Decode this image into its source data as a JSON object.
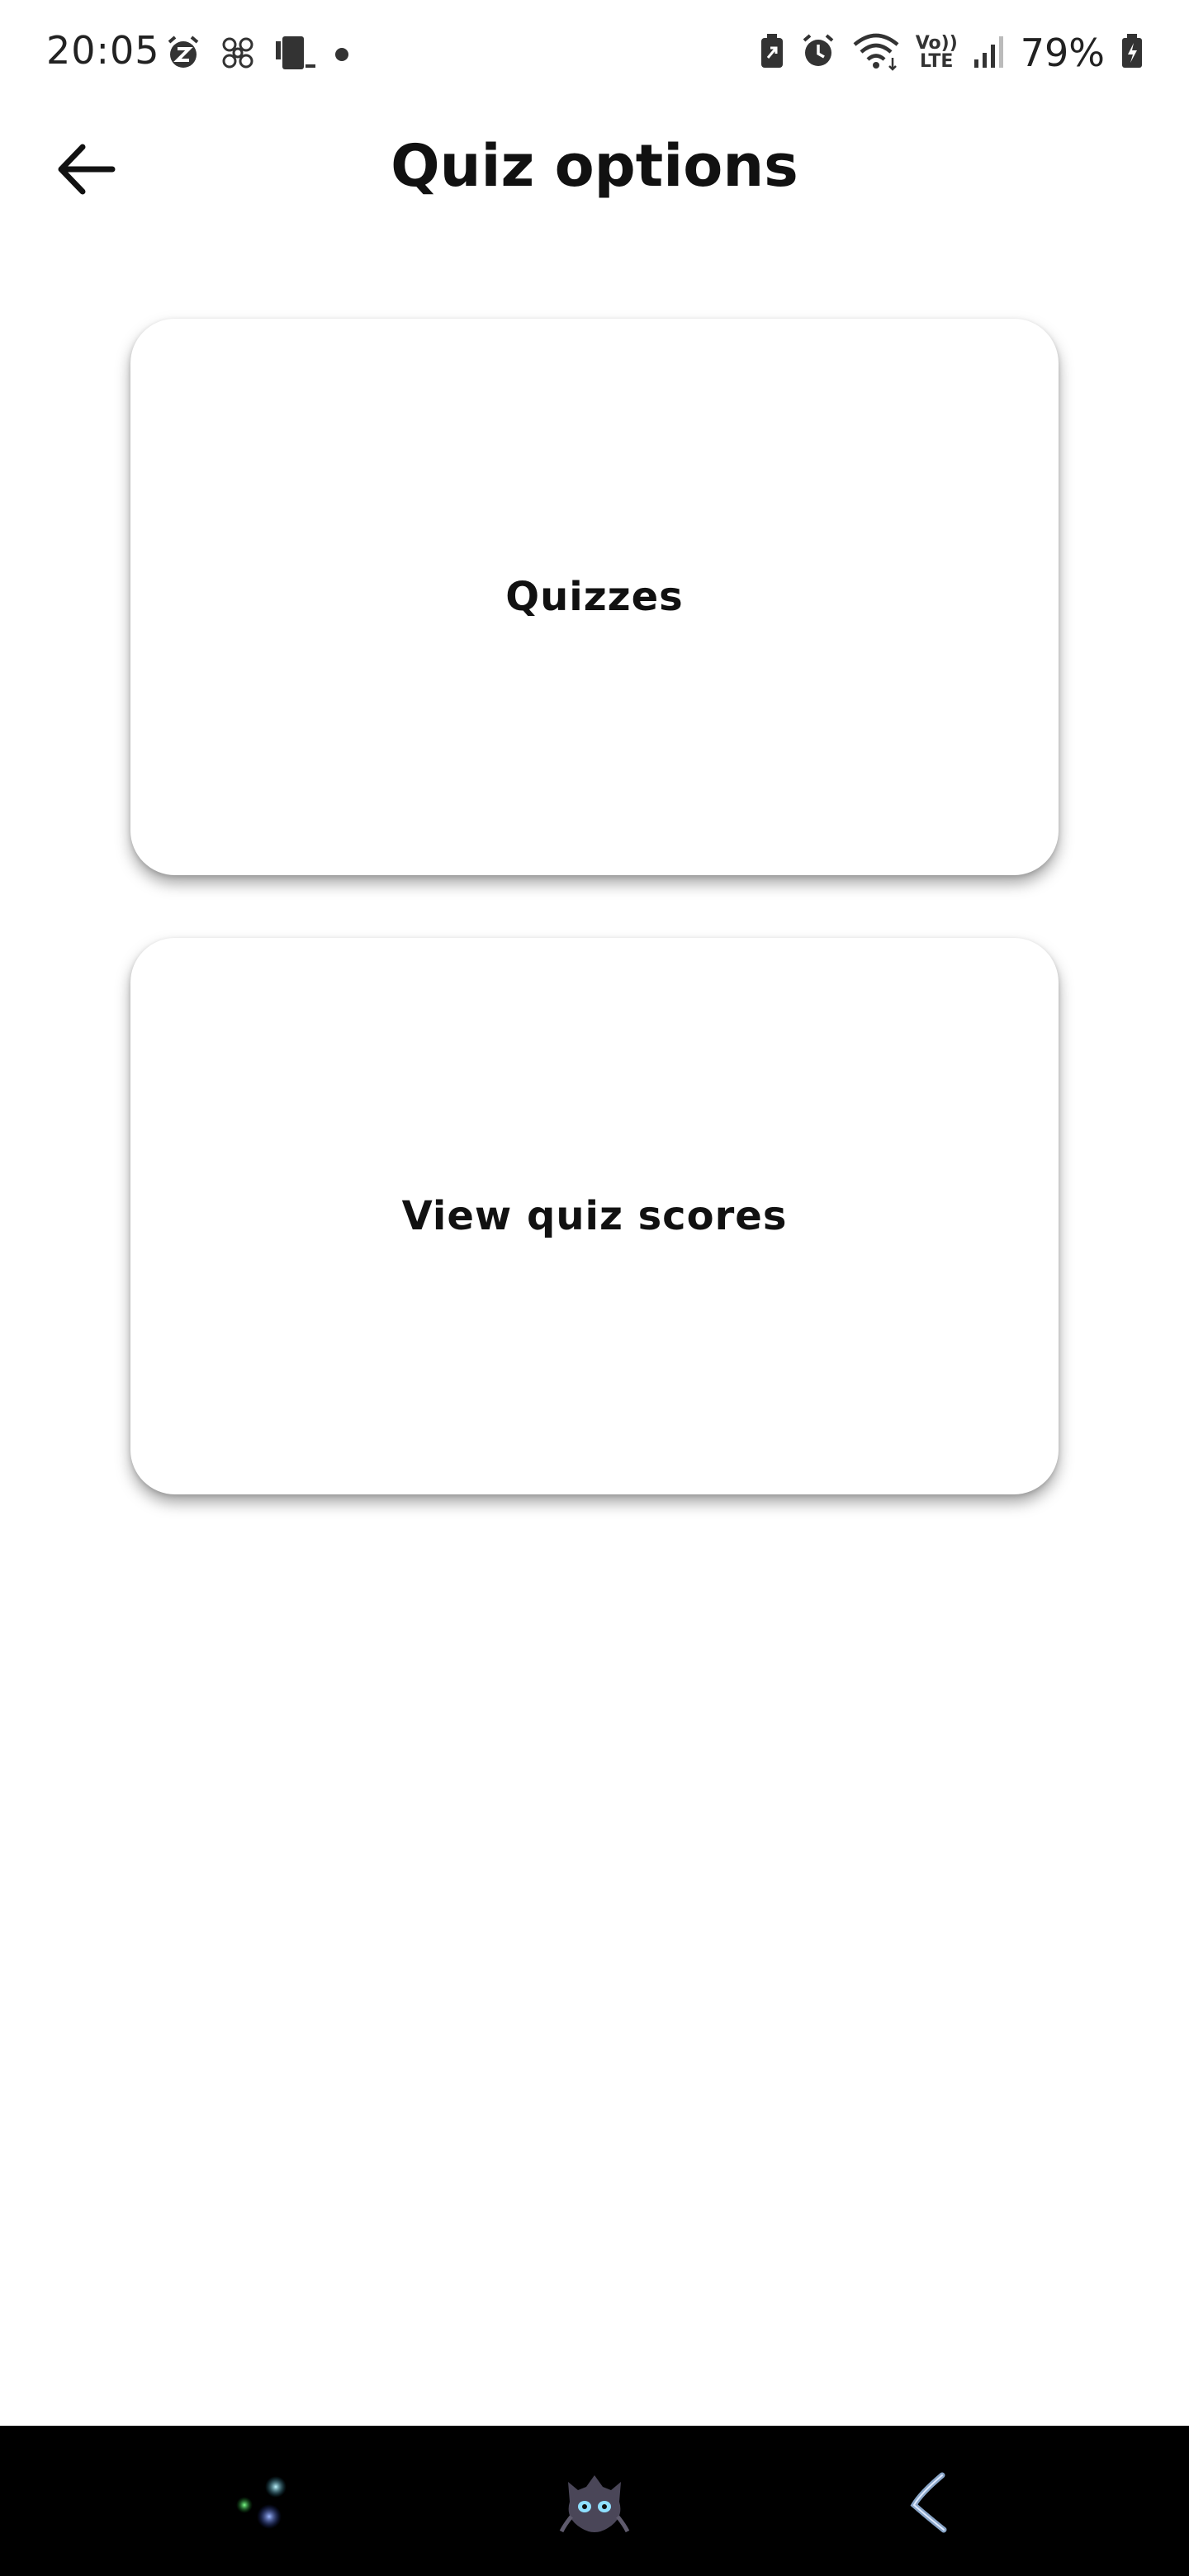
{
  "status_bar": {
    "time": "20:05",
    "battery_percent": "79%",
    "network_label_top": "Vo))",
    "network_label_bottom": "LTE",
    "left_icons": [
      "alarm-snooze-icon",
      "fan-icon",
      "device-icon",
      "notification-dot-icon"
    ],
    "right_icons": [
      "battery-saver-icon",
      "alarm-icon",
      "wifi-icon",
      "volte-icon",
      "signal-icon",
      "battery-icon"
    ]
  },
  "header": {
    "title": "Quiz options",
    "back_icon": "arrow-left-icon"
  },
  "cards": {
    "quizzes_label": "Quizzes",
    "scores_label": "View quiz scores"
  },
  "nav_bar": {
    "items": [
      "recents-icon",
      "home-icon",
      "back-icon"
    ]
  },
  "colors": {
    "background": "#ffffff",
    "text": "#111111",
    "nav_bar": "#000000"
  }
}
